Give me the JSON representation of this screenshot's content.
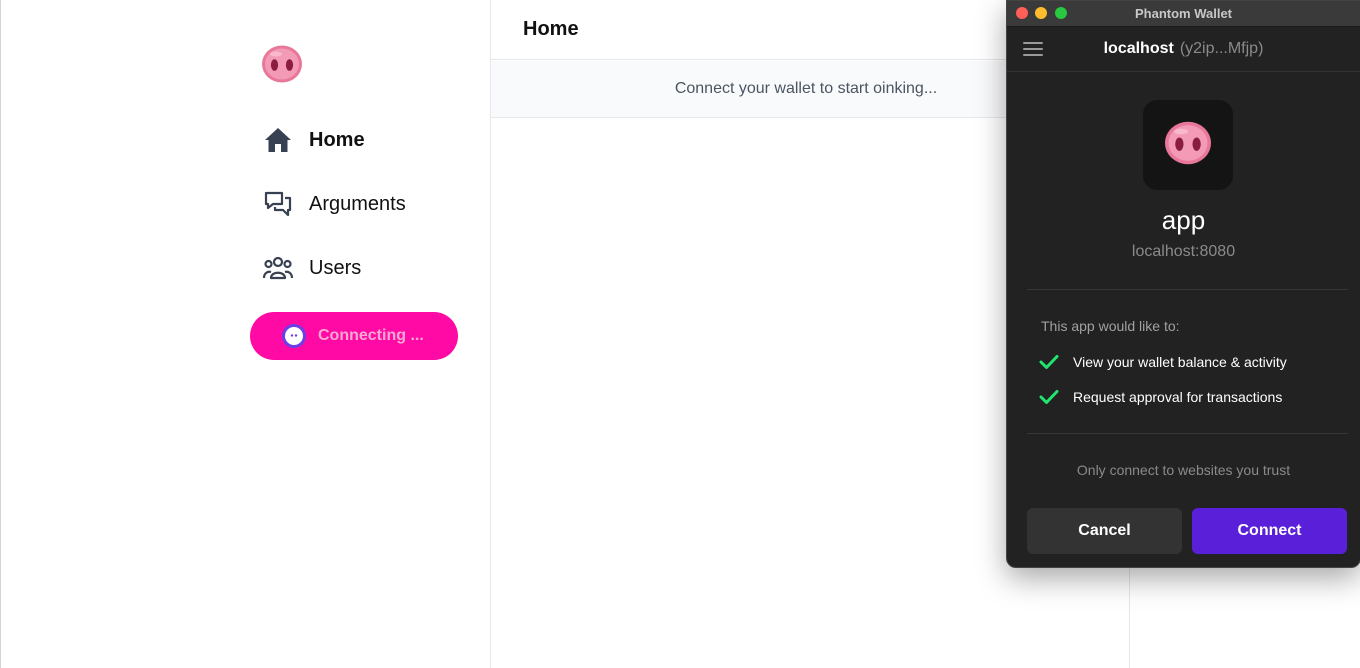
{
  "sidebar": {
    "logo_icon": "pig-snout-icon",
    "items": [
      {
        "label": "Home",
        "icon": "home-icon",
        "active": true
      },
      {
        "label": "Arguments",
        "icon": "chat-bubbles-icon",
        "active": false
      },
      {
        "label": "Users",
        "icon": "users-icon",
        "active": false
      }
    ],
    "connect_button": {
      "label": "Connecting ...",
      "icon": "phantom-ghost-icon",
      "color": "#ff0aa5"
    }
  },
  "main": {
    "title": "Home",
    "banner": "Connect your wallet to start oinking..."
  },
  "popup": {
    "window_title": "Phantom Wallet",
    "host_name": "localhost",
    "host_address": "(y2ip...Mfjp)",
    "app_icon": "pig-snout-icon",
    "app_name": "app",
    "app_url": "localhost:8080",
    "permissions_title": "This app would like to:",
    "permissions": [
      "View your wallet balance & activity",
      "Request approval for transactions"
    ],
    "trust_note": "Only connect to websites you trust",
    "cancel_label": "Cancel",
    "connect_label": "Connect",
    "accent_color": "#5a1fd8",
    "check_color": "#21e56f"
  }
}
